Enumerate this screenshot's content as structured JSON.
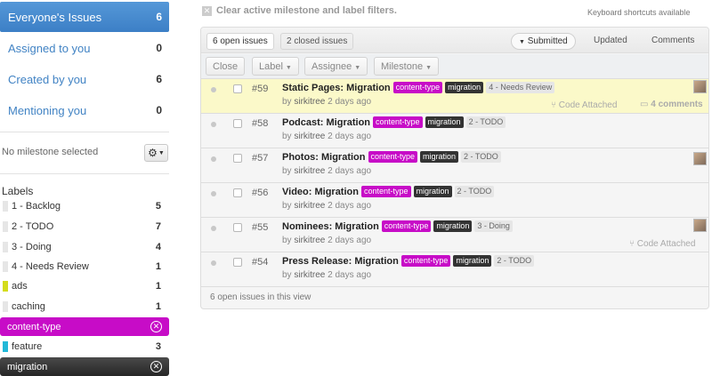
{
  "sidebar": {
    "filters": [
      {
        "label": "Everyone's Issues",
        "count": "6",
        "active": true
      },
      {
        "label": "Assigned to you",
        "count": "0",
        "active": false
      },
      {
        "label": "Created by you",
        "count": "6",
        "active": false
      },
      {
        "label": "Mentioning you",
        "count": "0",
        "active": false
      }
    ],
    "milestone_text": "No milestone selected",
    "gear_icon": "gear-icon",
    "labels_heading": "Labels",
    "labels": [
      {
        "name": "1 - Backlog",
        "count": "5",
        "color": "#e6e6e6"
      },
      {
        "name": "2 - TODO",
        "count": "7",
        "color": "#e6e6e6"
      },
      {
        "name": "3 - Doing",
        "count": "4",
        "color": "#e6e6e6"
      },
      {
        "name": "4 - Needs Review",
        "count": "1",
        "color": "#e6e6e6"
      },
      {
        "name": "ads",
        "count": "1",
        "color": "#d4dc1c"
      },
      {
        "name": "caching",
        "count": "1",
        "color": "#e6e6e6"
      },
      {
        "name": "content-type",
        "count": "",
        "color": "#c70cc7",
        "selected": true
      },
      {
        "name": "feature",
        "count": "3",
        "color": "#22b8d8"
      },
      {
        "name": "migration",
        "count": "",
        "color": "#333333",
        "selected": true
      }
    ]
  },
  "main": {
    "clear_filters": "Clear active milestone and label filters.",
    "keyboard_shortcuts": "Keyboard shortcuts available",
    "tabs": {
      "open": "6 open issues",
      "closed": "2 closed issues"
    },
    "sort": {
      "submitted": "Submitted",
      "updated": "Updated",
      "comments": "Comments"
    },
    "toolbar": {
      "close": "Close",
      "label": "Label",
      "assignee": "Assignee",
      "milestone": "Milestone"
    },
    "issues": [
      {
        "number": "#59",
        "title": "Static Pages: Migration",
        "labels": [
          "content-type",
          "migration",
          "4 - Needs Review"
        ],
        "author": "sirkitree",
        "time": "2 days ago",
        "highlighted": true,
        "avatar": true,
        "code_attached": "Code Attached",
        "comments": "4 comments"
      },
      {
        "number": "#58",
        "title": "Podcast: Migration",
        "labels": [
          "content-type",
          "migration",
          "2 - TODO"
        ],
        "author": "sirkitree",
        "time": "2 days ago"
      },
      {
        "number": "#57",
        "title": "Photos: Migration",
        "labels": [
          "content-type",
          "migration",
          "2 - TODO"
        ],
        "author": "sirkitree",
        "time": "2 days ago",
        "avatar": true
      },
      {
        "number": "#56",
        "title": "Video: Migration",
        "labels": [
          "content-type",
          "migration",
          "2 - TODO"
        ],
        "author": "sirkitree",
        "time": "2 days ago"
      },
      {
        "number": "#55",
        "title": "Nominees: Migration",
        "labels": [
          "content-type",
          "migration",
          "3 - Doing"
        ],
        "author": "sirkitree",
        "time": "2 days ago",
        "avatar": true,
        "code_attached": "Code Attached"
      },
      {
        "number": "#54",
        "title": "Press Release: Migration",
        "labels": [
          "content-type",
          "migration",
          "2 - TODO"
        ],
        "author": "sirkitree",
        "time": "2 days ago"
      }
    ],
    "footer": "6 open issues in this view",
    "label_colors": {
      "content-type": "#c70cc7",
      "migration": "#333333",
      "workflow": "#e6e6e6"
    }
  }
}
